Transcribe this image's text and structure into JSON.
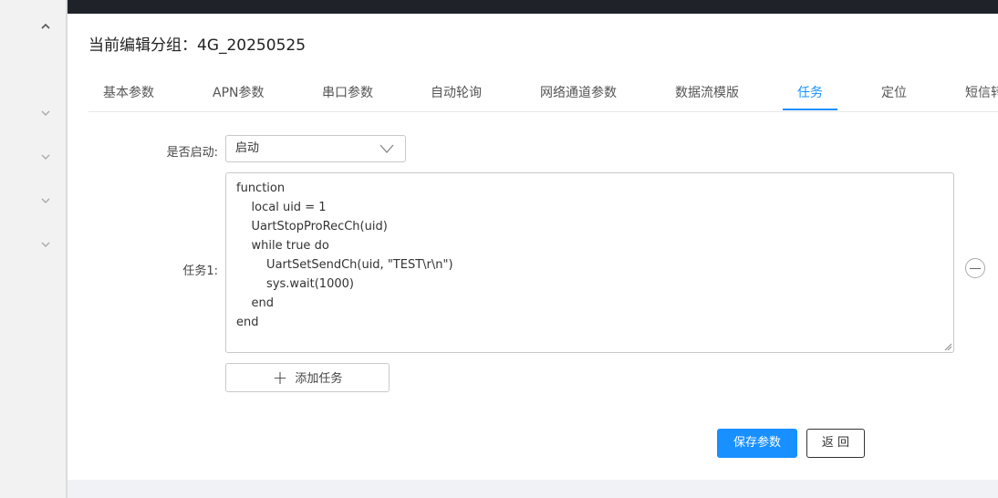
{
  "header": {
    "title": "当前编辑分组：4G_20250525"
  },
  "tabs": [
    {
      "label": "基本参数",
      "active": false
    },
    {
      "label": "APN参数",
      "active": false
    },
    {
      "label": "串口参数",
      "active": false
    },
    {
      "label": "自动轮询",
      "active": false
    },
    {
      "label": "网络通道参数",
      "active": false
    },
    {
      "label": "数据流模版",
      "active": false
    },
    {
      "label": "任务",
      "active": true
    },
    {
      "label": "定位",
      "active": false
    },
    {
      "label": "短信转",
      "active": false
    }
  ],
  "form": {
    "enable_label": "是否启动:",
    "enable_value": "启动",
    "task_label": "任务1:",
    "task_code_lines": [
      "function",
      "    local uid = 1",
      "    UartStopProRecCh(uid)",
      "    while true do",
      "        UartSetSendCh(uid, \"TEST\\r\\n\")",
      "        sys.wait(1000)",
      "    end",
      "end"
    ],
    "add_task_label": "添加任务"
  },
  "actions": {
    "save_label": "保存参数",
    "back_label": "返 回"
  },
  "colors": {
    "accent": "#1890ff",
    "topbar": "#1f2329",
    "sidebar": "#f2f2f2"
  },
  "icons": {
    "sidebar_toggle": "chevron-up-icon",
    "sidebar_items": "chevron-down-icon",
    "select_arrow": "chevron-down-icon",
    "remove_task": "minus-circle-icon",
    "add_task": "plus-icon"
  }
}
